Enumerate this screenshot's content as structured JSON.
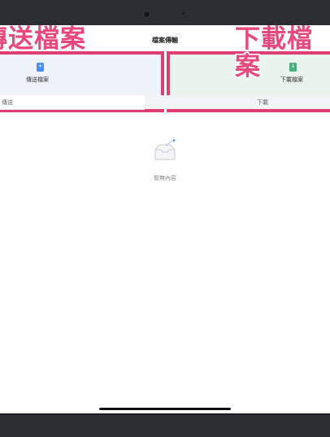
{
  "navbar": {
    "title": "檔案傳輸"
  },
  "overlay": {
    "left_text": "傳送檔案",
    "right_text": "下載檔案"
  },
  "cards": {
    "upload": {
      "label": "傳送檔案",
      "icon": "file-upload-icon"
    },
    "download": {
      "label": "下載檔案",
      "icon": "file-download-icon"
    }
  },
  "tabs": [
    {
      "label": "傳送"
    },
    {
      "label": "下載"
    }
  ],
  "empty_state": {
    "message": "暫無內容",
    "icon": "empty-tray-icon"
  },
  "colors": {
    "highlight": "#e03e72",
    "upload_bg": "#eef2fa",
    "download_bg": "#e9f4ec",
    "upload_icon": "#4a8ef0",
    "download_icon": "#4cb07a"
  }
}
